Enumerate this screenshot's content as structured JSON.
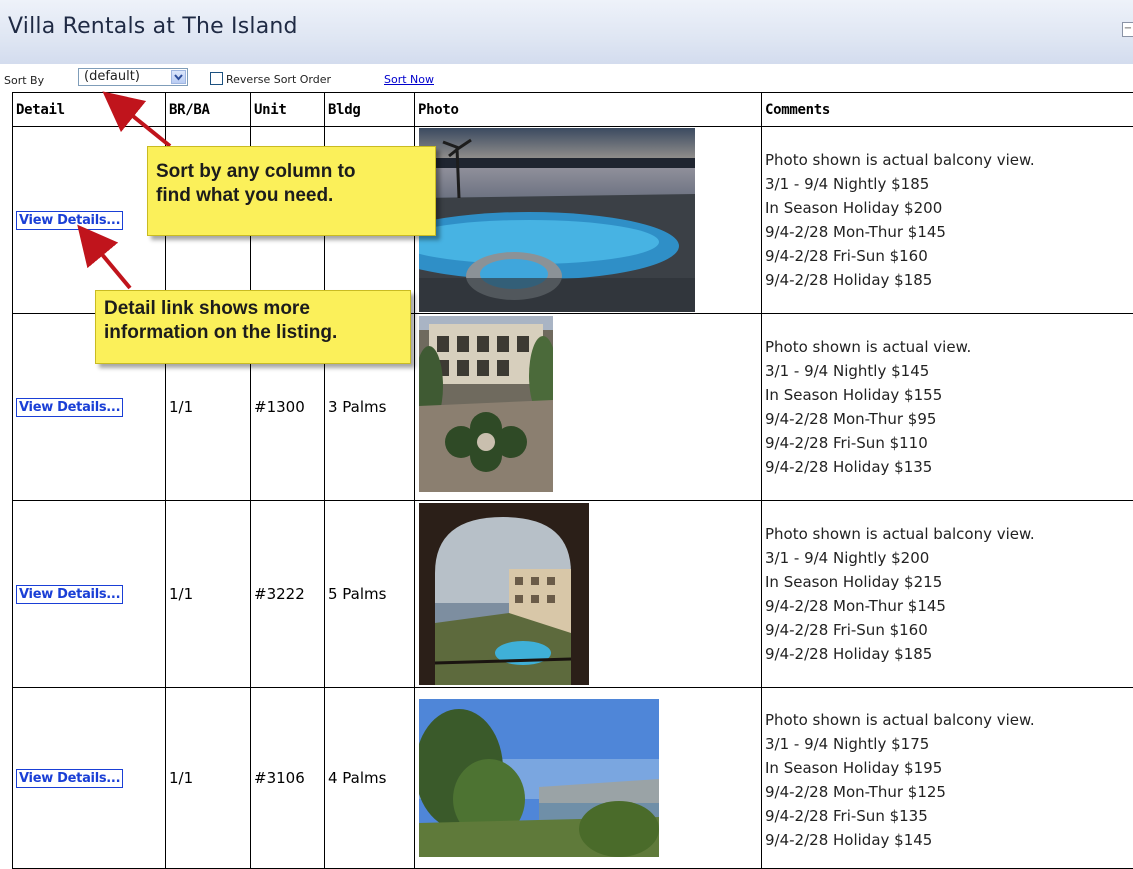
{
  "header": {
    "title": "Villa Rentals at The Island",
    "collapse_icon": "minus-box-icon"
  },
  "toolbar": {
    "sort_label": "Sort By",
    "sort_value": "(default)",
    "reverse_label": "Reverse Sort Order",
    "reverse_checked": false,
    "sort_now": "Sort Now"
  },
  "table": {
    "headers": [
      "Detail",
      "BR/BA",
      "Unit",
      "Bldg",
      "Photo",
      "Comments"
    ],
    "rows": [
      {
        "detail": "View Details...",
        "brba": "",
        "unit": "",
        "bldg": "",
        "photo": "pool-at-dusk-photo",
        "comments": [
          "Photo shown is actual balcony view.",
          "3/1 - 9/4 Nightly $185",
          "In Season Holiday $200",
          "9/4-2/28 Mon-Thur $145",
          "9/4-2/28 Fri-Sun $160",
          "9/4-2/28 Holiday $185"
        ]
      },
      {
        "detail": "View Details...",
        "brba": "1/1",
        "unit": "#1300",
        "bldg": "3 Palms",
        "photo": "courtyard-garden-photo",
        "comments": [
          "Photo shown is actual view.",
          "3/1 - 9/4 Nightly $145",
          "In Season Holiday $155",
          "9/4-2/28 Mon-Thur $95",
          "9/4-2/28 Fri-Sun $110",
          "9/4-2/28 Holiday $135"
        ]
      },
      {
        "detail": "View Details...",
        "brba": "1/1",
        "unit": "#3222",
        "bldg": "5 Palms",
        "photo": "arched-balcony-lake-photo",
        "comments": [
          "Photo shown is actual balcony view.",
          "3/1 - 9/4 Nightly $200",
          "In Season Holiday $215",
          "9/4-2/28 Mon-Thur $145",
          "9/4-2/28 Fri-Sun $160",
          "9/4-2/28 Holiday $185"
        ]
      },
      {
        "detail": "View Details...",
        "brba": "1/1",
        "unit": "#3106",
        "bldg": "4 Palms",
        "photo": "trees-and-lake-photo",
        "comments": [
          "Photo shown is actual balcony view.",
          "3/1 - 9/4 Nightly $175",
          "In Season Holiday $195",
          "9/4-2/28 Mon-Thur $125",
          "9/4-2/28 Fri-Sun $135",
          "9/4-2/28 Holiday $145"
        ]
      }
    ]
  },
  "callouts": {
    "sort": [
      "Sort by any column to",
      "find what you need."
    ],
    "detail": [
      "Detail link shows more",
      "information on the listing."
    ]
  },
  "colors": {
    "header_bg": "#dfe6f3",
    "callout_bg": "#fbf05a",
    "arrow": "#c0141c",
    "link": "#1a3fd6"
  }
}
